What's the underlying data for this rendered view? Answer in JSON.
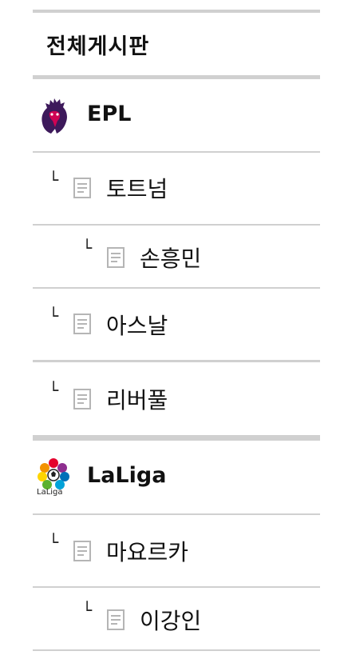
{
  "menu": {
    "title": "전체게시판",
    "branch_glyph": "└",
    "boards": [
      {
        "name": "EPL",
        "logo_icon": "premier-league-lion-icon",
        "items": [
          {
            "label": "토트넘",
            "icon": "document-icon"
          },
          {
            "label": "손흥민",
            "icon": "document-icon"
          },
          {
            "label": "아스날",
            "icon": "document-icon"
          },
          {
            "label": "리버풀",
            "icon": "document-icon"
          }
        ]
      },
      {
        "name": "LaLiga",
        "logo_icon": "laliga-logo-icon",
        "logo_text": "LaLiga",
        "items": [
          {
            "label": "마요르카",
            "icon": "document-icon"
          },
          {
            "label": "이강인",
            "icon": "document-icon"
          }
        ]
      }
    ]
  },
  "colors": {
    "thick_divider": "#c8c8c8",
    "thin_divider": "#d6d6d6",
    "epl_purple": "#3d195b",
    "doc_icon": "#b5b5b5"
  }
}
